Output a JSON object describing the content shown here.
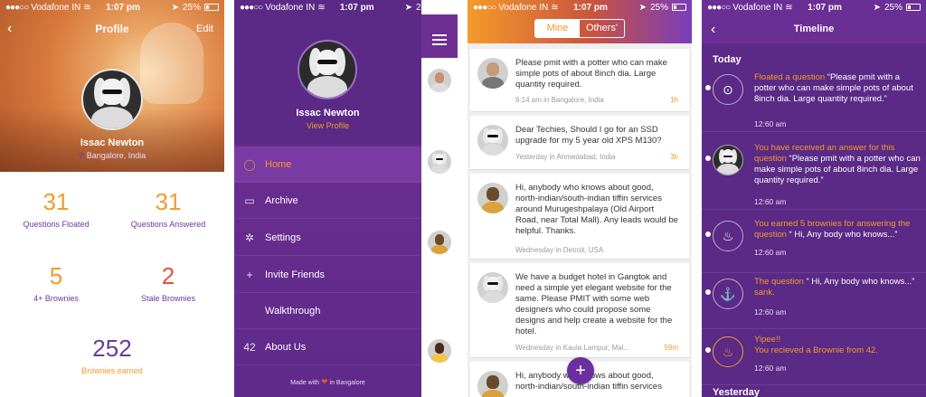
{
  "status": {
    "carrier": "Vodafone IN",
    "time": "1:07 pm",
    "battery": "25%"
  },
  "profile": {
    "title": "Profile",
    "edit_label": "Edit",
    "name": "Issac Newton",
    "location": "Bangalore, India",
    "stats": [
      {
        "value": "31",
        "label": "Questions Floated"
      },
      {
        "value": "31",
        "label": "Questions Answered"
      },
      {
        "value": "5",
        "label": "4+ Brownies"
      },
      {
        "value": "2",
        "label": "Stale Brownies"
      },
      {
        "value": "252",
        "label": "Brownies earned"
      }
    ]
  },
  "menu": {
    "name": "Issac Newton",
    "view_profile": "View Profile",
    "items": [
      {
        "label": "Home",
        "icon": "balloon-icon"
      },
      {
        "label": "Archive",
        "icon": "archive-icon"
      },
      {
        "label": "Settings",
        "icon": "settings-icon"
      },
      {
        "label": "Invite Friends",
        "icon": "plus-icon"
      },
      {
        "label": "Walkthrough",
        "icon": ""
      },
      {
        "label": "About Us",
        "icon": "42"
      }
    ],
    "footer_pre": "Made with",
    "footer_post": "in Bangalore"
  },
  "feed": {
    "tab_mine": "Mine",
    "tab_others": "Others'",
    "posts": [
      {
        "text": "Please pmit with a potter who can make simple pots of about 8inch dia. Large quantity required.",
        "meta": "6:14 am in Bangalore, India",
        "badge": "1h"
      },
      {
        "text": "Dear Techies, Should I go for an SSD upgrade for my 5 year old XPS M130?",
        "meta": "Yesterday in Ahmedabad, India",
        "badge": "3h"
      },
      {
        "text": "Hi, anybody who knows about good, north-indian/south-indian tiffin services around Murugeshpalaya (Old Airport Road, near Total Mall). Any leads would be helpful. Thanks.",
        "meta": "Wednesday in Detroit, USA",
        "badge": ""
      },
      {
        "text": "We have a budget hotel in Gangtok and need a simple yet elegant website for the same. Please PMIT with some web designers who could propose some designs and help create a website for the hotel.",
        "meta": "Wednesday in Kaula Lampur, Mal...",
        "badge": "59m"
      },
      {
        "text": "Hi, anybody who knows about good, north-indian/south-indian tiffin services",
        "meta": "",
        "badge": ""
      }
    ],
    "fab": "+"
  },
  "timeline": {
    "title": "Timeline",
    "section_today": "Today",
    "section_yesterday": "Yesterday",
    "items": [
      {
        "icon": "balloon-icon",
        "hl": "Floated a question",
        "text": " “Please pmit with a potter who can make simple pots of about 8inch dia. Large quantity required.”",
        "time": "12:60 am"
      },
      {
        "icon": "avatar",
        "hl": "You have received an answer for this question",
        "text": " “Please pmit with a potter who can make simple pots of about 8inch dia. Large quantity required.”",
        "time": "12:60 am"
      },
      {
        "icon": "cupcake-icon",
        "hl": "You earned 5 brownies for answering the question",
        "text": " “ Hi, Any body who knows...”",
        "time": "12:60 am"
      },
      {
        "icon": "anchor-icon",
        "hl": "The question",
        "text": " “ Hi, Any body who knows...”",
        "hl2": " sank.",
        "time": "12:60 am"
      },
      {
        "icon": "cupcake-icon",
        "hl": "Yipee!!\nYou recieved a Brownie from 42.",
        "text": "",
        "time": "12:60 am"
      }
    ]
  }
}
